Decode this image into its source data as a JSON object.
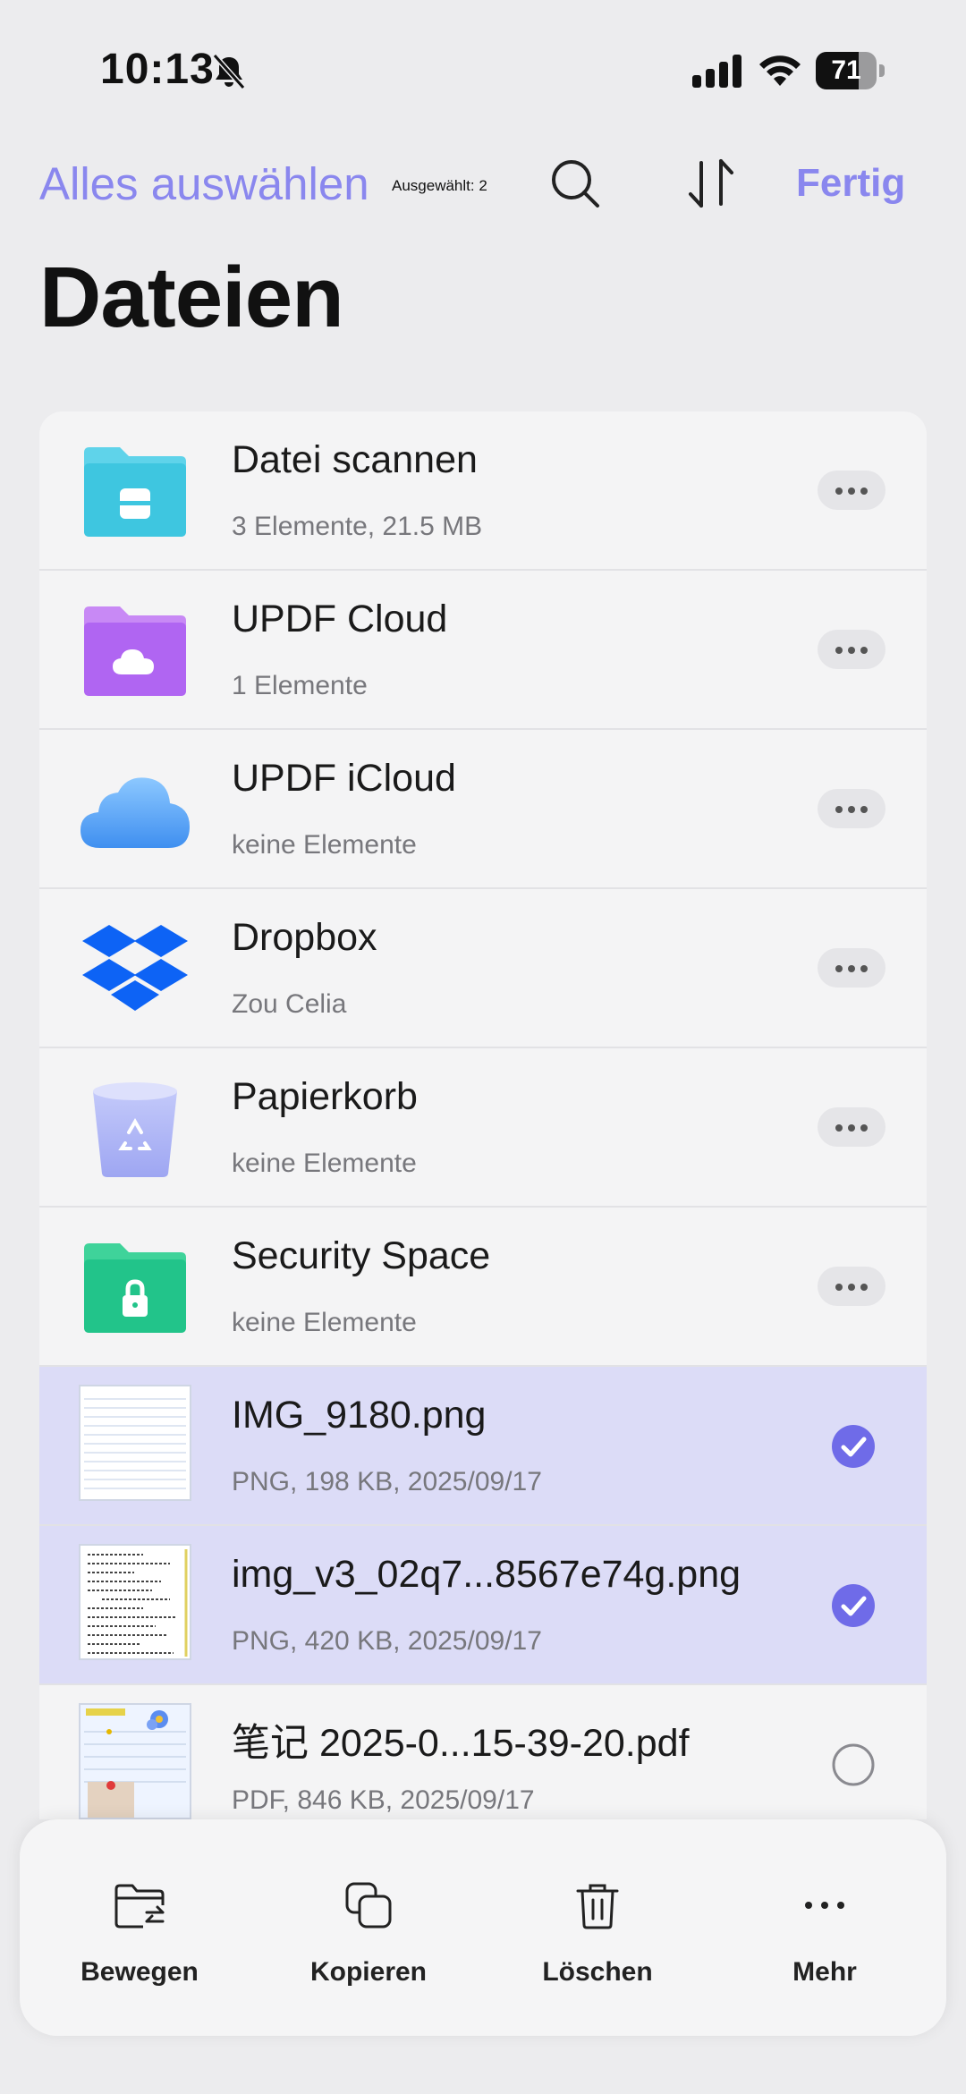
{
  "status": {
    "time": "10:13",
    "battery": "71",
    "battery_level": 0.71
  },
  "nav": {
    "select_all": "Alles auswählen",
    "selected_count": "Ausgewählt: 2",
    "done": "Fertig"
  },
  "title": "Dateien",
  "items": [
    {
      "title": "Datei scannen",
      "subtitle": "3 Elemente, 21.5 MB",
      "icon": "scan-folder-icon",
      "color": "#3ec6e0"
    },
    {
      "title": "UPDF Cloud",
      "subtitle": "1 Elemente",
      "icon": "cloud-folder-icon",
      "color": "#b065f2"
    },
    {
      "title": "UPDF iCloud",
      "subtitle": "keine Elemente",
      "icon": "icloud-icon",
      "color": "#4f9cf0"
    },
    {
      "title": "Dropbox",
      "subtitle": "Zou Celia",
      "icon": "dropbox-icon",
      "color": "#0d63f5"
    },
    {
      "title": "Papierkorb",
      "subtitle": "keine Elemente",
      "icon": "trash-bin-icon",
      "color": "#aab2f5"
    },
    {
      "title": "Security Space",
      "subtitle": "keine Elemente",
      "icon": "lock-folder-icon",
      "color": "#22c48a"
    },
    {
      "title": "IMG_9180.png",
      "subtitle": "PNG, 198 KB, 2025/09/17",
      "selected": true
    },
    {
      "title": "img_v3_02q7...8567e74g.png",
      "subtitle": "PNG, 420 KB, 2025/09/17",
      "selected": true
    },
    {
      "title": " 笔记 2025-0...15-39-20.pdf",
      "subtitle": "PDF, 846 KB, 2025/09/17",
      "selected": false
    }
  ],
  "toolbar": {
    "move": "Bewegen",
    "copy": "Kopieren",
    "delete": "Löschen",
    "more": "Mehr"
  },
  "colors": {
    "accent": "#8a87ee",
    "selected_row": "#dcdcf7",
    "check": "#6f6be8"
  }
}
